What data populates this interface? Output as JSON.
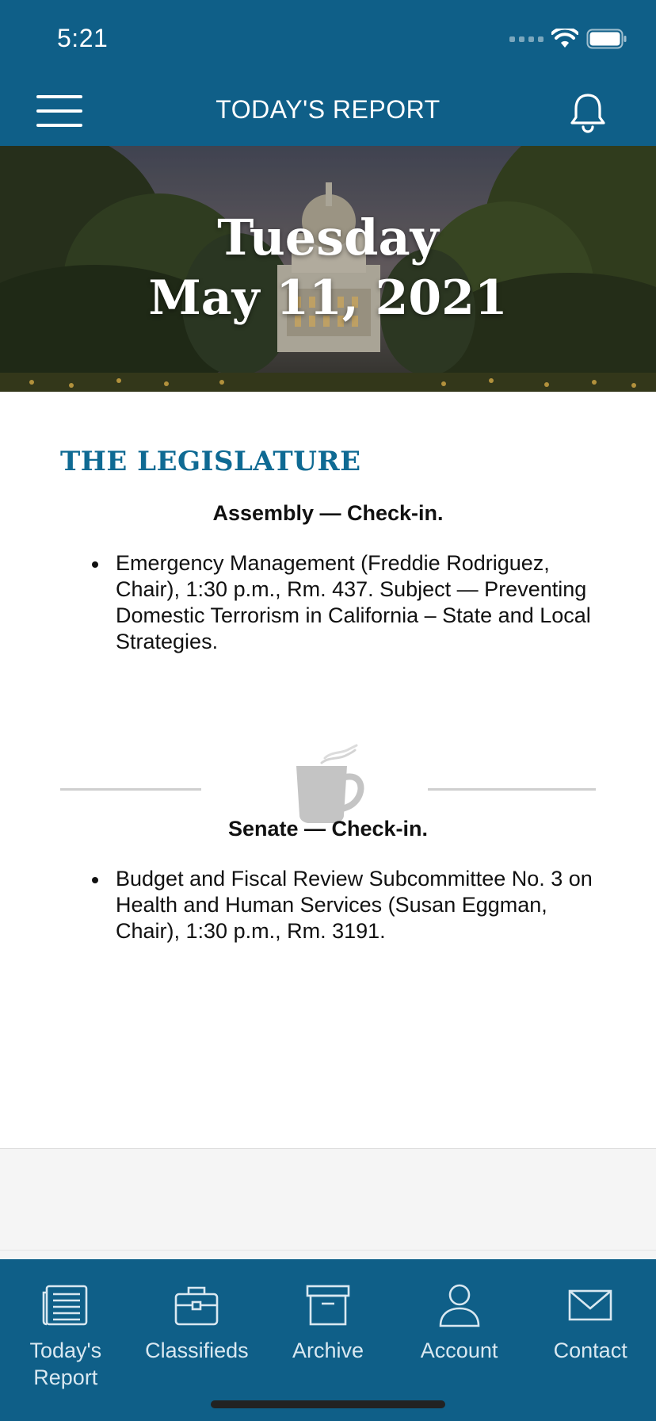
{
  "status_bar": {
    "time": "5:21"
  },
  "nav": {
    "title": "TODAY'S REPORT",
    "menu_icon": "hamburger-menu-icon",
    "bell_icon": "bell-icon"
  },
  "hero": {
    "day": "Tuesday",
    "date": "May 11, 2021"
  },
  "content": {
    "section_heading": "THE LEGISLATURE",
    "assembly": {
      "heading": "Assembly — Check-in.",
      "items": [
        "Emergency Management (Freddie Rodriguez, Chair), 1:30 p.m., Rm. 437. Subject — Preventing Domestic Terrorism in California – State and Local Strategies."
      ]
    },
    "divider_icon": "coffee-mug-icon",
    "senate": {
      "heading": "Senate — Check-in.",
      "items": [
        "Budget and Fiscal Review Subcommittee No. 3 on Health and Human Services (Susan Eggman, Chair), 1:30 p.m., Rm. 3191."
      ]
    }
  },
  "tabs": [
    {
      "label": "Today's Report",
      "icon": "newspaper-icon"
    },
    {
      "label": "Classifieds",
      "icon": "briefcase-icon"
    },
    {
      "label": "Archive",
      "icon": "archive-box-icon"
    },
    {
      "label": "Account",
      "icon": "person-icon"
    },
    {
      "label": "Contact",
      "icon": "envelope-icon"
    }
  ],
  "colors": {
    "brand_blue": "#0f5f88",
    "heading_blue": "#0f6a93"
  }
}
